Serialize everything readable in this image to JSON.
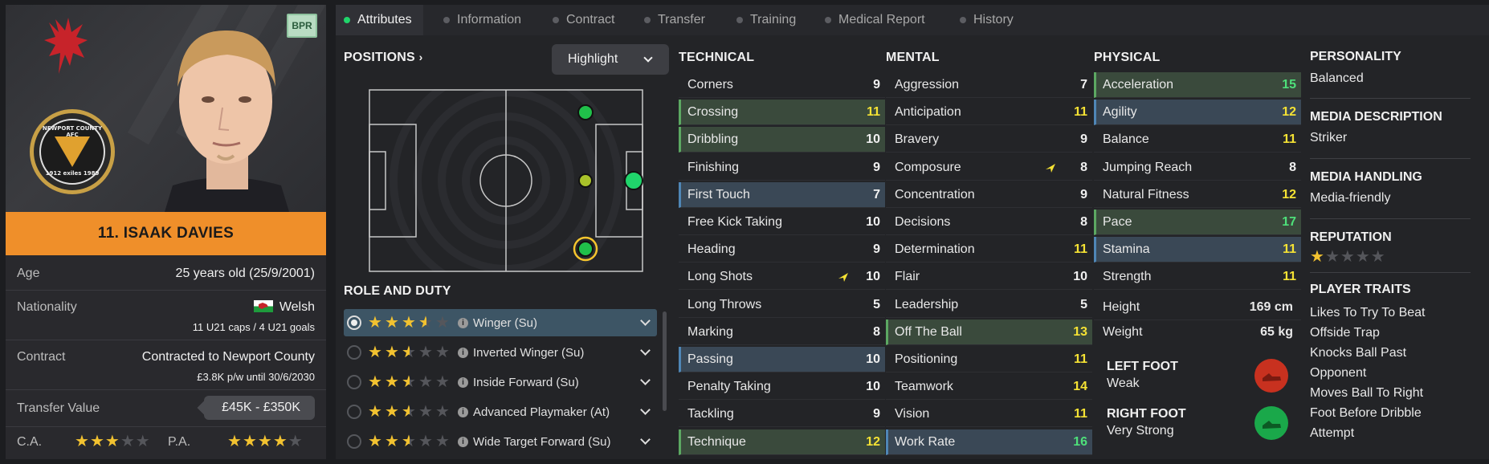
{
  "player": {
    "name": "11. ISAAK DAVIES",
    "badge": "BPR",
    "crest_top": "NEWPORT COUNTY AFC",
    "crest_bottom": "1912 exiles 1989",
    "age_label": "Age",
    "age_value": "25 years old (25/9/2001)",
    "nationality_label": "Nationality",
    "nationality_value": "Welsh",
    "nationality_caps": "11 U21 caps / 4 U21 goals",
    "contract_label": "Contract",
    "contract_value": "Contracted to Newport County",
    "contract_sub": "£3.8K p/w until 30/6/2030",
    "transfer_label": "Transfer Value",
    "transfer_value": "£45K - £350K",
    "ca_label": "C.A.",
    "ca_stars": 3,
    "pa_label": "P.A.",
    "pa_stars": 4
  },
  "tabs": [
    {
      "label": "Attributes",
      "active": true
    },
    {
      "label": "Information"
    },
    {
      "label": "Contract"
    },
    {
      "label": "Transfer"
    },
    {
      "label": "Training"
    },
    {
      "label": "Medical Report"
    },
    {
      "label": "History"
    }
  ],
  "positions": {
    "header": "POSITIONS",
    "highlight_label": "Highlight"
  },
  "role_duty": {
    "header": "ROLE AND DUTY",
    "roles": [
      {
        "label": "Winger (Su)",
        "stars": 3.5,
        "selected": true
      },
      {
        "label": "Inverted Winger (Su)",
        "stars": 2.5
      },
      {
        "label": "Inside Forward (Su)",
        "stars": 2.5
      },
      {
        "label": "Advanced Playmaker (At)",
        "stars": 2.5
      },
      {
        "label": "Wide Target Forward (Su)",
        "stars": 2.5
      }
    ]
  },
  "technical": {
    "header": "TECHNICAL",
    "attrs": [
      {
        "name": "Corners",
        "value": "9"
      },
      {
        "name": "Crossing",
        "value": "11",
        "hl": "g"
      },
      {
        "name": "Dribbling",
        "value": "10",
        "hl": "g"
      },
      {
        "name": "Finishing",
        "value": "9"
      },
      {
        "name": "First Touch",
        "value": "7",
        "hl": "b"
      },
      {
        "name": "Free Kick Taking",
        "value": "10"
      },
      {
        "name": "Heading",
        "value": "9"
      },
      {
        "name": "Long Shots",
        "value": "10",
        "arrow": true
      },
      {
        "name": "Long Throws",
        "value": "5"
      },
      {
        "name": "Marking",
        "value": "8"
      },
      {
        "name": "Passing",
        "value": "10",
        "hl": "b"
      },
      {
        "name": "Penalty Taking",
        "value": "10"
      },
      {
        "name": "Tackling",
        "value": "9"
      },
      {
        "name": "Technique",
        "value": "12",
        "hl": "g"
      }
    ]
  },
  "mental": {
    "header": "MENTAL",
    "attrs": [
      {
        "name": "Aggression",
        "value": "7"
      },
      {
        "name": "Anticipation",
        "value": "11"
      },
      {
        "name": "Bravery",
        "value": "9"
      },
      {
        "name": "Composure",
        "value": "8",
        "arrow": true
      },
      {
        "name": "Concentration",
        "value": "9"
      },
      {
        "name": "Decisions",
        "value": "8"
      },
      {
        "name": "Determination",
        "value": "11"
      },
      {
        "name": "Flair",
        "value": "10"
      },
      {
        "name": "Leadership",
        "value": "5"
      },
      {
        "name": "Off The Ball",
        "value": "13",
        "hl": "g"
      },
      {
        "name": "Positioning",
        "value": "11"
      },
      {
        "name": "Teamwork",
        "value": "14"
      },
      {
        "name": "Vision",
        "value": "11"
      },
      {
        "name": "Work Rate",
        "value": "16",
        "hl": "b"
      }
    ]
  },
  "physical": {
    "header": "PHYSICAL",
    "attrs": [
      {
        "name": "Acceleration",
        "value": "15",
        "hl": "g"
      },
      {
        "name": "Agility",
        "value": "12",
        "hl": "b"
      },
      {
        "name": "Balance",
        "value": "11"
      },
      {
        "name": "Jumping Reach",
        "value": "8"
      },
      {
        "name": "Natural Fitness",
        "value": "12"
      },
      {
        "name": "Pace",
        "value": "17",
        "hl": "g"
      },
      {
        "name": "Stamina",
        "value": "11",
        "hl": "b"
      },
      {
        "name": "Strength",
        "value": "11"
      }
    ],
    "height_label": "Height",
    "height_value": "169 cm",
    "weight_label": "Weight",
    "weight_value": "65 kg",
    "left_foot_label": "LEFT FOOT",
    "left_foot_value": "Weak",
    "right_foot_label": "RIGHT FOOT",
    "right_foot_value": "Very Strong"
  },
  "profile": {
    "personality_label": "PERSONALITY",
    "personality_value": "Balanced",
    "media_desc_label": "MEDIA DESCRIPTION",
    "media_desc_value": "Striker",
    "media_handling_label": "MEDIA HANDLING",
    "media_handling_value": "Media-friendly",
    "reputation_label": "REPUTATION",
    "reputation_stars": 1,
    "traits_label": "PLAYER TRAITS",
    "traits": [
      "Likes To Try To Beat",
      "Offside Trap",
      "Knocks Ball Past",
      "Opponent",
      "Moves Ball To Right",
      "Foot Before Dribble",
      "Attempt"
    ]
  },
  "colors": {
    "accent_orange": "#ef8f2a",
    "highlight_green": "#3a4a3c",
    "highlight_blue": "#3a4856",
    "value_yellow": "#f5e234",
    "value_green": "#4ee07a",
    "star": "#f2c230",
    "weak_foot": "#c8311f",
    "strong_foot": "#1aa84a"
  }
}
